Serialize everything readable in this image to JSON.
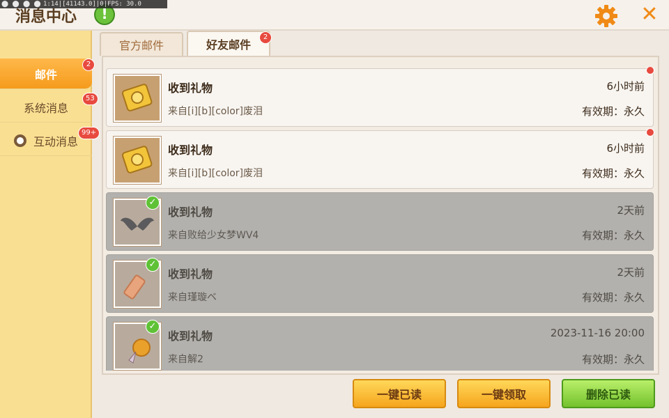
{
  "app": {
    "title": "消息中心",
    "debug_text": "1:14|[41143.0]|0|FPS: 30.0"
  },
  "colors": {
    "accent": "#f59b1c",
    "badge": "#e84a3f",
    "check": "#5fc236"
  },
  "sidebar": {
    "items": [
      {
        "label": "邮件",
        "badge": "2",
        "active": true
      },
      {
        "label": "系统消息",
        "badge": "53",
        "active": false
      },
      {
        "label": "互动消息",
        "badge": "99+",
        "active": false
      }
    ]
  },
  "tabs": [
    {
      "label": "官方邮件",
      "active": false
    },
    {
      "label": "好友邮件",
      "active": true,
      "badge": "2"
    }
  ],
  "mails": [
    {
      "title": "收到礼物",
      "from": "来自[i][b][color]废泪",
      "time": "6小时前",
      "validity": "有效期：永久",
      "state": "unread",
      "icon": "gold-coupon-icon"
    },
    {
      "title": "收到礼物",
      "from": "来自[i][b][color]废泪",
      "time": "6小时前",
      "validity": "有效期：永久",
      "state": "unread",
      "icon": "gold-coupon-icon"
    },
    {
      "title": "收到礼物",
      "from": "来自败给少女梦WV4",
      "time": "2天前",
      "validity": "有效期：永久",
      "state": "read",
      "icon": "dark-wings-icon"
    },
    {
      "title": "收到礼物",
      "from": "来自瑾璇ベ",
      "time": "2天前",
      "validity": "有效期：永久",
      "state": "read",
      "icon": "ribbon-ticket-icon"
    },
    {
      "title": "收到礼物",
      "from": "来自解2",
      "time": "2023-11-16 20:00",
      "validity": "有效期：永久",
      "state": "read",
      "icon": "candy-shell-icon"
    }
  ],
  "buttons": {
    "mark_all_read": "一键已读",
    "claim_all": "一键领取",
    "delete_read": "删除已读"
  }
}
